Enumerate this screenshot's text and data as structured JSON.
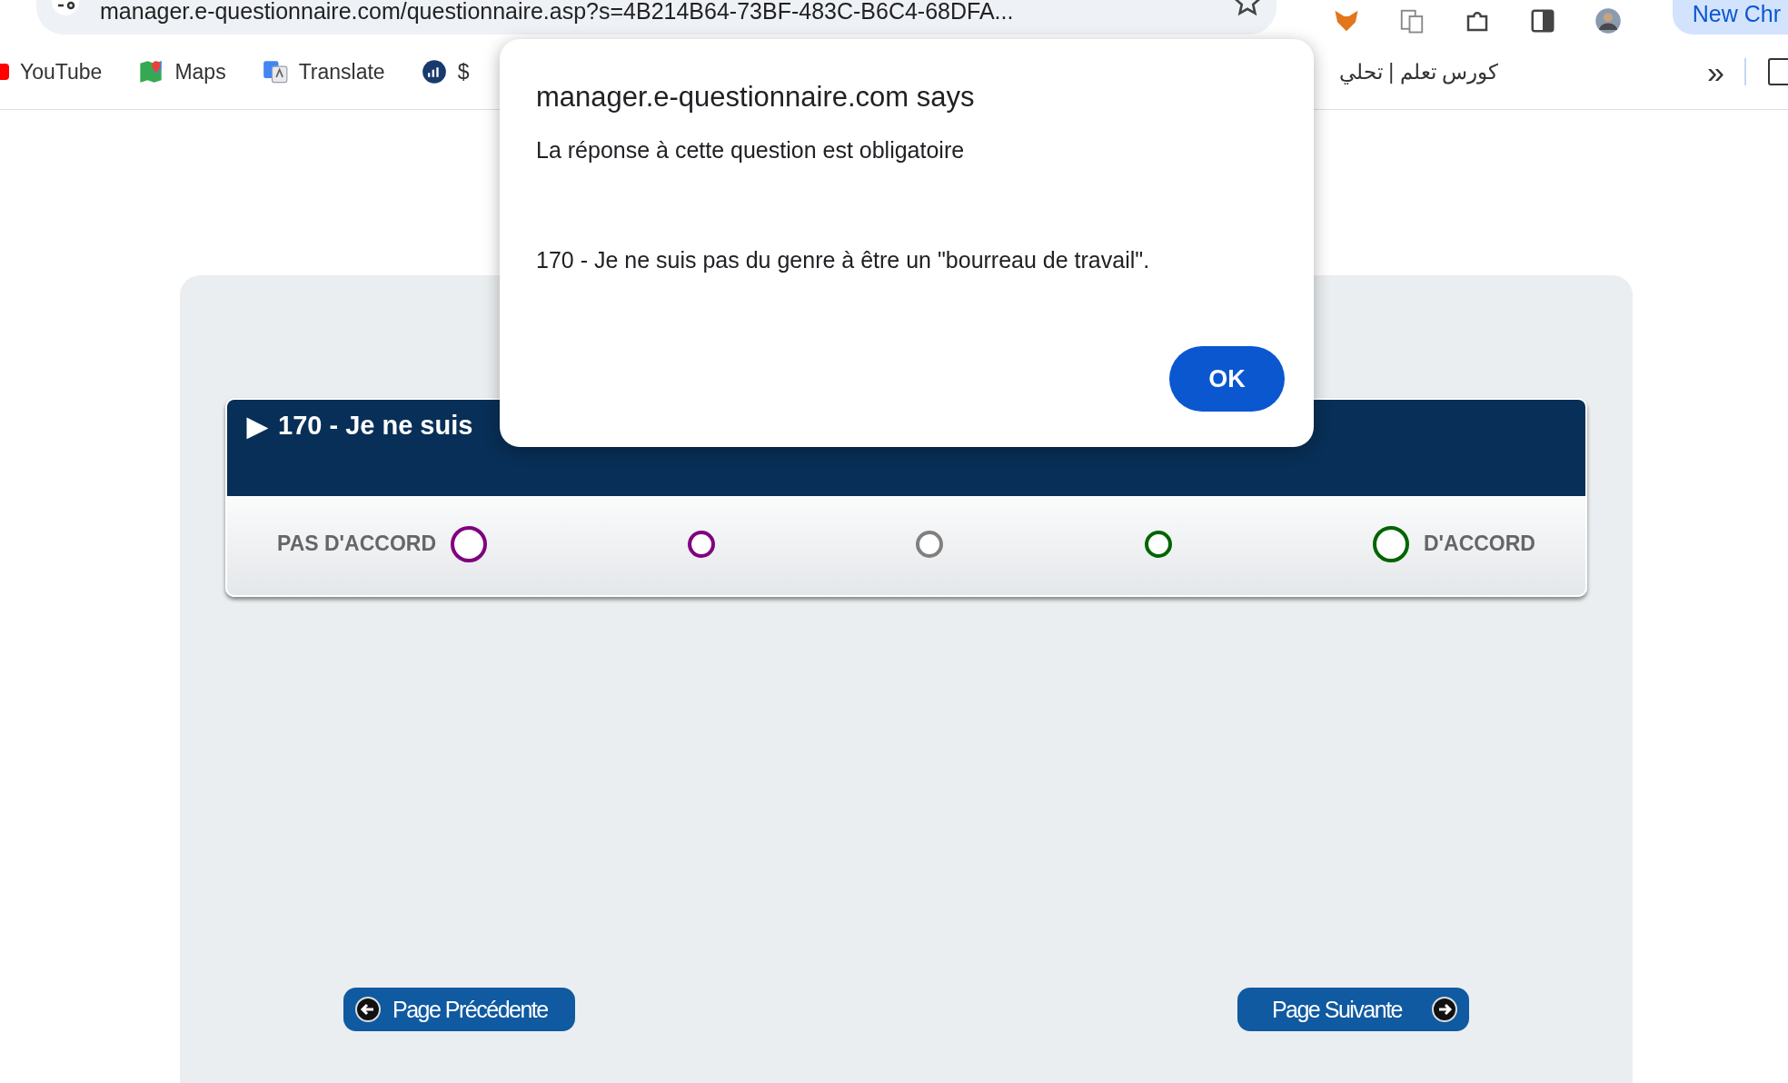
{
  "browser": {
    "url": "manager.e-questionnaire.com/questionnaire.asp?s=4B214B64-73BF-483C-B6C4-68DFA...",
    "profile_button": "New Chr",
    "bookmarks": [
      {
        "label": "YouTube",
        "kind": "youtube"
      },
      {
        "label": "Maps",
        "kind": "maps"
      },
      {
        "label": "Translate",
        "kind": "translate"
      },
      {
        "label": "$",
        "kind": "chart"
      }
    ],
    "bookmark_right": "كورس تعلم | تحلي",
    "overflow": "»"
  },
  "question": {
    "title": "170 - Je ne suis",
    "marker": "▶",
    "left_label": "PAS D'ACCORD",
    "right_label": "D'ACCORD",
    "options": [
      {
        "kind": "large",
        "color": "#800080",
        "selected": false
      },
      {
        "kind": "small",
        "color": "#800080",
        "selected": false
      },
      {
        "kind": "small",
        "color": "#808080",
        "selected": false
      },
      {
        "kind": "small",
        "color": "#006400",
        "selected": false
      },
      {
        "kind": "large",
        "color": "#006400",
        "selected": false
      }
    ]
  },
  "nav": {
    "previous": "Page Précédente",
    "next": "Page Suivante"
  },
  "dialog": {
    "title": "manager.e-questionnaire.com says",
    "message": "La réponse à cette question est obligatoire",
    "detail": "170 - Je ne suis pas du genre à être un \"bourreau de travail\".",
    "button": "OK"
  }
}
